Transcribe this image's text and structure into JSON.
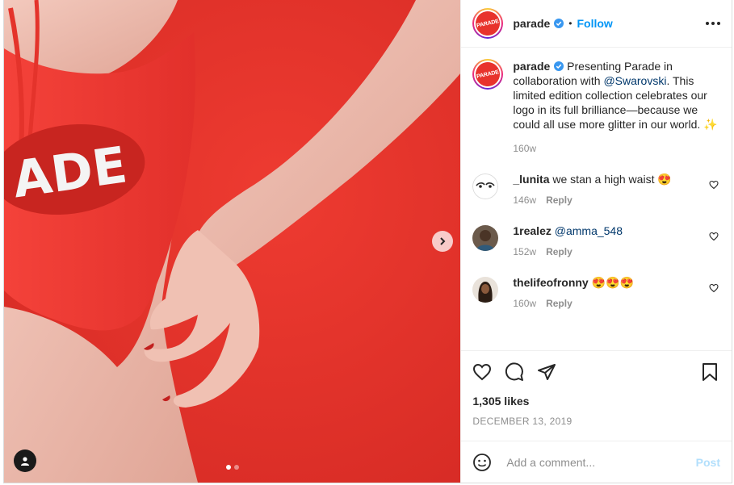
{
  "post": {
    "username": "parade",
    "follow_label": "Follow",
    "separator": "•",
    "avatar_text": "PARADE",
    "caption": {
      "username": "parade",
      "text_before": " Presenting Parade in collaboration with ",
      "mention": "@Swarovski",
      "text_after": ". This limited edition collection celebrates our logo in its full brilliance—because we could all use more glitter in our world. ✨",
      "time": "160w"
    },
    "comments": [
      {
        "username": "_lunita",
        "text": " we stan a high waist 😍",
        "time": "146w",
        "reply": "Reply"
      },
      {
        "username": "1realez",
        "mention": "@amma_548",
        "text": "",
        "time": "152w",
        "reply": "Reply"
      },
      {
        "username": "thelifeofronny",
        "text": " 😍😍😍",
        "time": "160w",
        "reply": "Reply"
      }
    ],
    "likes": "1,305 likes",
    "date": "DECEMBER 13, 2019",
    "comment_placeholder": "Add a comment...",
    "post_label": "Post"
  },
  "media": {
    "garment_text": "ADE",
    "carousel_count": 2,
    "carousel_active": 1
  },
  "colors": {
    "brand_red": "#e8332c",
    "follow_blue": "#0095f6",
    "mention_blue": "#00376b",
    "post_disabled": "#b2dffc"
  }
}
